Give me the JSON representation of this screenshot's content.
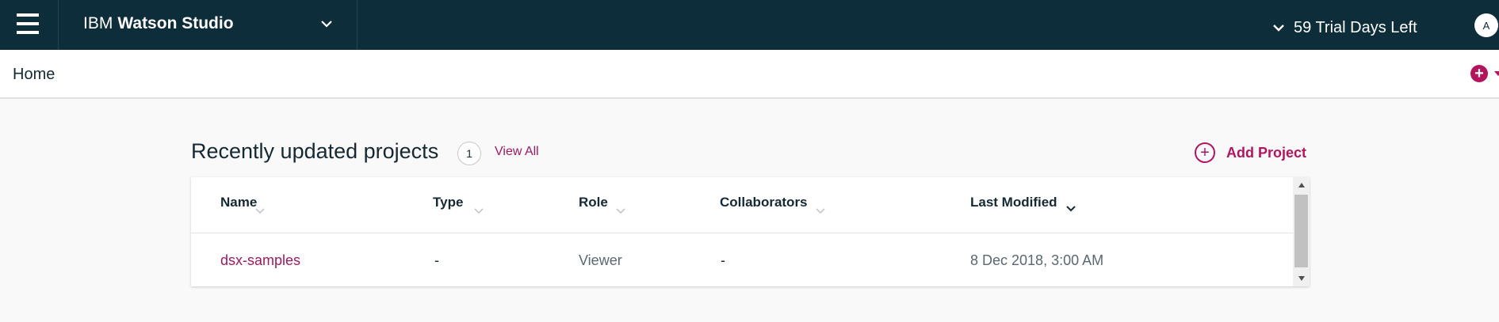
{
  "topbar": {
    "brand_ibm": "IBM",
    "brand_product": "Watson Studio",
    "trial_text": "59 Trial Days Left",
    "avatar_initial": "A"
  },
  "breadcrumb": {
    "home": "Home"
  },
  "section": {
    "title": "Recently updated projects",
    "count": "1",
    "view_all": "View All",
    "add_project": "Add Project"
  },
  "table": {
    "columns": [
      "Name",
      "Type",
      "Role",
      "Collaborators",
      "Last Modified"
    ],
    "rows": [
      {
        "name": "dsx-samples",
        "type": "-",
        "role": "Viewer",
        "collaborators": "-",
        "last_modified": "8 Dec 2018, 3:00 AM"
      }
    ]
  },
  "colors": {
    "header_bg": "#0d2d3b",
    "accent": "#b4145b"
  }
}
